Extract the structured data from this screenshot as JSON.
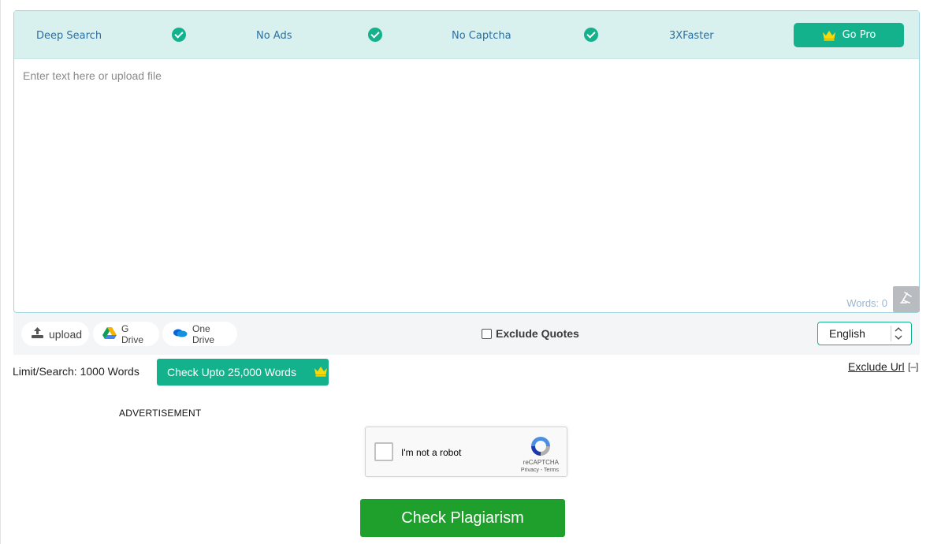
{
  "features": [
    {
      "label": "Deep Search"
    },
    {
      "label": "No Ads"
    },
    {
      "label": "No Captcha"
    },
    {
      "label": "3XFaster"
    }
  ],
  "go_pro_label": "Go Pro",
  "editor": {
    "placeholder": "Enter text here or upload file",
    "words_label": "Words: 0"
  },
  "upload_bar": {
    "upload_label": "upload",
    "gdrive_label": "G Drive",
    "onedrive_label": "One Drive",
    "exclude_quotes_label": "Exclude Quotes",
    "language": "English"
  },
  "limit": {
    "text": "Limit/Search: 1000 Words",
    "upgrade_label": "Check Upto 25,000 Words",
    "exclude_url_label": "Exclude Url",
    "exclude_url_toggle": "[–]"
  },
  "advertisement_label": "ADVERTISEMENT",
  "recaptcha": {
    "label": "I'm not a robot",
    "brand": "reCAPTCHA",
    "links": "Privacy - Terms"
  },
  "check_button_label": "Check Plagiarism",
  "colors": {
    "accent": "#13b28c",
    "check_button": "#1fa02c",
    "crown": "#f5d90a",
    "feature_text": "#2f6f9f"
  },
  "icons": [
    "check-circle-icon",
    "crown-icon",
    "upload-icon",
    "google-drive-icon",
    "onedrive-icon",
    "clear-text-icon",
    "recaptcha-logo-icon"
  ]
}
